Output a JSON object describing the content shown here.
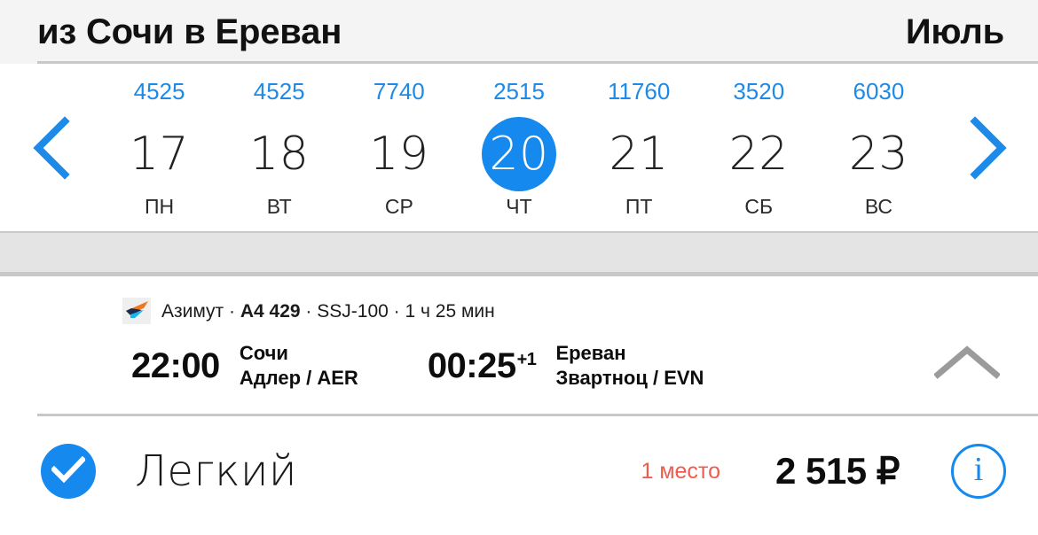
{
  "header": {
    "route_title": "из Сочи в Ереван",
    "month": "Июль"
  },
  "calendar": {
    "prev_icon": "chevron-left-icon",
    "next_icon": "chevron-right-icon",
    "days": [
      {
        "price": "4525",
        "day": "17",
        "dow": "ПН",
        "selected": false
      },
      {
        "price": "4525",
        "day": "18",
        "dow": "ВТ",
        "selected": false
      },
      {
        "price": "7740",
        "day": "19",
        "dow": "СР",
        "selected": false
      },
      {
        "price": "2515",
        "day": "20",
        "dow": "ЧТ",
        "selected": true
      },
      {
        "price": "11760",
        "day": "21",
        "dow": "ПТ",
        "selected": false
      },
      {
        "price": "3520",
        "day": "22",
        "dow": "СБ",
        "selected": false
      },
      {
        "price": "6030",
        "day": "23",
        "dow": "ВС",
        "selected": false
      }
    ]
  },
  "flight": {
    "airline": "Азимут",
    "flight_number": "A4 429",
    "aircraft": "SSJ-100",
    "duration": "1 ч 25 мин",
    "separator": "·",
    "logo_icon": "azimuth-airline-logo",
    "departure": {
      "time": "22:00",
      "day_offset": "",
      "city": "Сочи",
      "airport": "Адлер / AER"
    },
    "arrival": {
      "time": "00:25",
      "day_offset": "+1",
      "city": "Ереван",
      "airport": "Звартноц / EVN"
    },
    "collapse_icon": "chevron-up-icon"
  },
  "fare": {
    "selected_icon": "check-circle-icon",
    "name": "Легкий",
    "seats_left": "1 место",
    "price": "2 515 ₽",
    "info_icon": "info-circle-icon",
    "info_label": "i"
  },
  "colors": {
    "accent_blue": "#1589ee",
    "price_blue": "#1e8ae8",
    "warning_red": "#ef5c4e",
    "header_bg": "#f4f4f4",
    "band_bg": "#e4e4e4",
    "divider": "#c8c8c8"
  }
}
